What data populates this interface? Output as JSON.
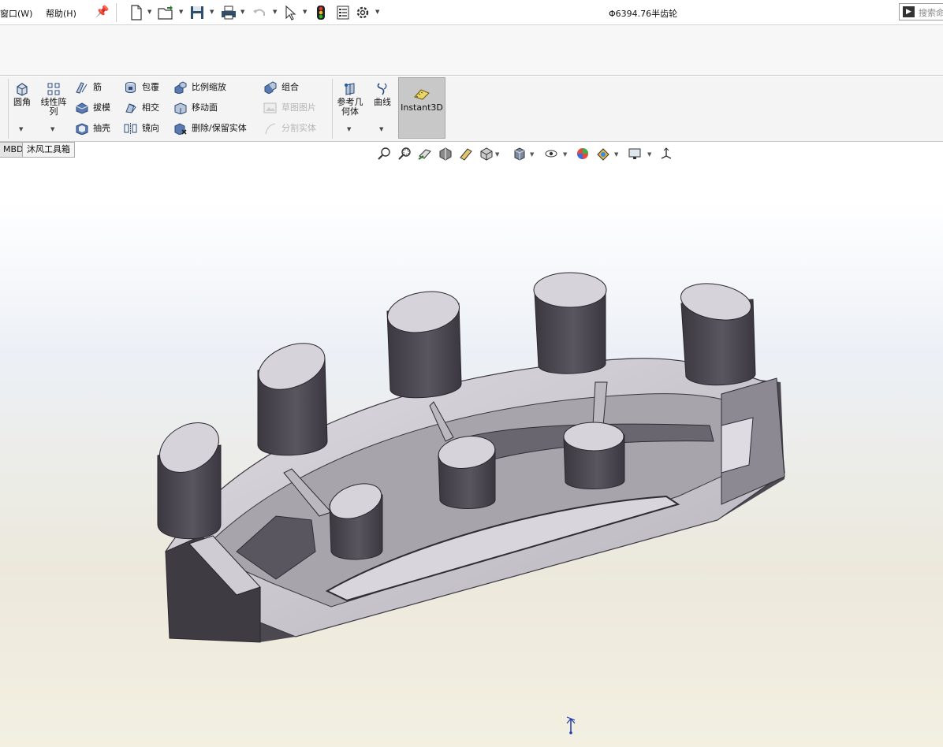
{
  "menu": {
    "window_label": "窗口(W)",
    "help_label": "帮助(H)"
  },
  "quick_access_icons": [
    "new-document-icon",
    "open-icon",
    "save-icon",
    "print-icon",
    "undo-icon",
    "select-icon",
    "rebuild-icon",
    "file-properties-icon",
    "options-icon"
  ],
  "document": {
    "title": "Φ6394.76半齿轮"
  },
  "search": {
    "label": "搜索命"
  },
  "ribbon": {
    "fillet": "圆角",
    "linear_pattern_line1": "线性阵",
    "linear_pattern_line2": "列",
    "rib": "筋",
    "draft": "拔模",
    "shell": "抽壳",
    "wrap": "包覆",
    "intersect": "相交",
    "mirror": "镜向",
    "scale": "比例缩放",
    "move_face": "移动面",
    "delete_keep_body": "删除/保留实体",
    "combine": "组合",
    "sketch_picture": "草图图片",
    "split_body": "分割实体",
    "ref_geometry_line1": "参考几",
    "ref_geometry_line2": "何体",
    "curves": "曲线",
    "instant3d": "Instant3D"
  },
  "tabs": {
    "mbd": "MBD",
    "toolbox": "沐风工具箱"
  },
  "heads_up_icons": [
    "zoom-to-fit-icon",
    "zoom-to-area-icon",
    "previous-view-icon",
    "section-view-icon",
    "dynamic-annotation-icon",
    "view-orientation-icon",
    "display-style-icon",
    "hide-show-items-icon",
    "edit-appearance-icon",
    "apply-scene-icon",
    "view-settings-icon",
    "triad-icon"
  ],
  "colors": {
    "accent": "#1e5aa8",
    "instant3d_bg": "#c8c8c8",
    "model_face": "#c9c6cc",
    "model_side": "#4b4850"
  }
}
